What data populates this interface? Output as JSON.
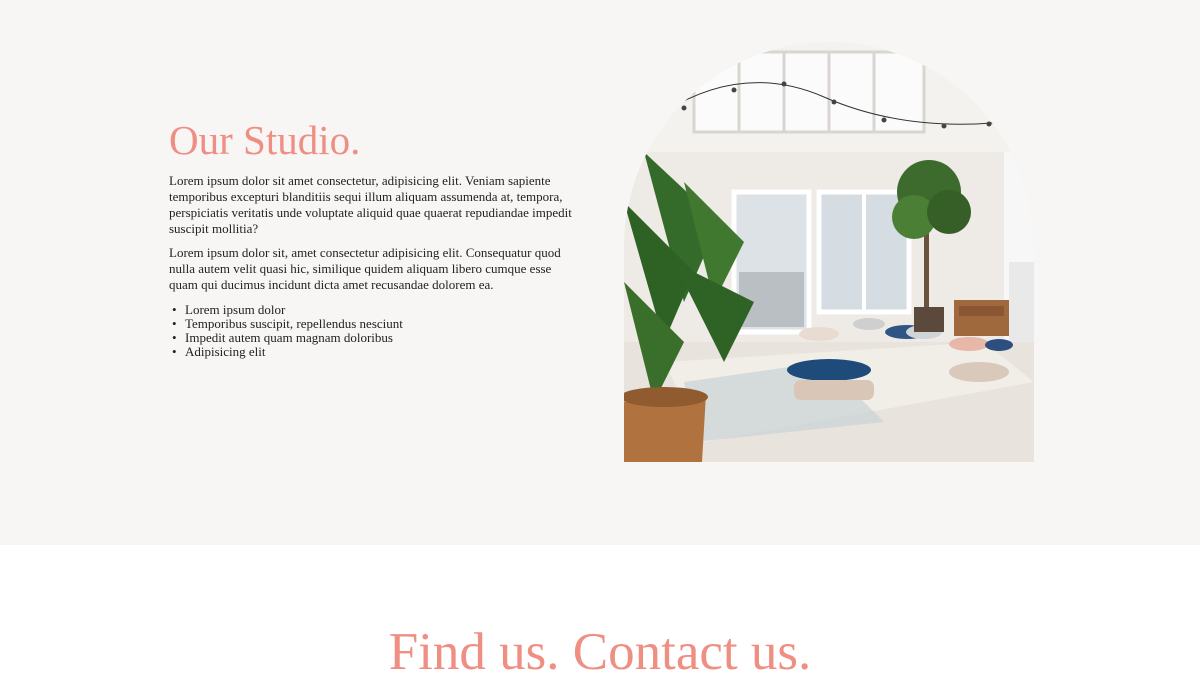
{
  "studio": {
    "title": "Our Studio.",
    "paragraphs": [
      "Lorem ipsum dolor sit amet consectetur, adipisicing elit. Veniam sapiente temporibus excepturi blanditiis sequi illum aliquam assumenda at, tempora, perspiciatis veritatis unde voluptate aliquid quae quaerat repudiandae impedit suscipit mollitia?",
      "Lorem ipsum dolor sit, amet consectetur adipisicing elit. Consequatur quod nulla autem velit quasi hic, similique quidem aliquam libero cumque esse quam qui ducimus incidunt dicta amet recusandae dolorem ea."
    ],
    "bullets": [
      "Lorem ipsum dolor",
      "Temporibus suscipit, repellendus nesciunt",
      "Impedit autem quam magnam doloribus",
      "Adipisicing elit"
    ],
    "photo_icon": "studio-photo",
    "colors": {
      "accent": "#ef8f83",
      "section_bg": "#f8f6f5"
    }
  },
  "contact": {
    "title": "Find us. Contact us."
  }
}
